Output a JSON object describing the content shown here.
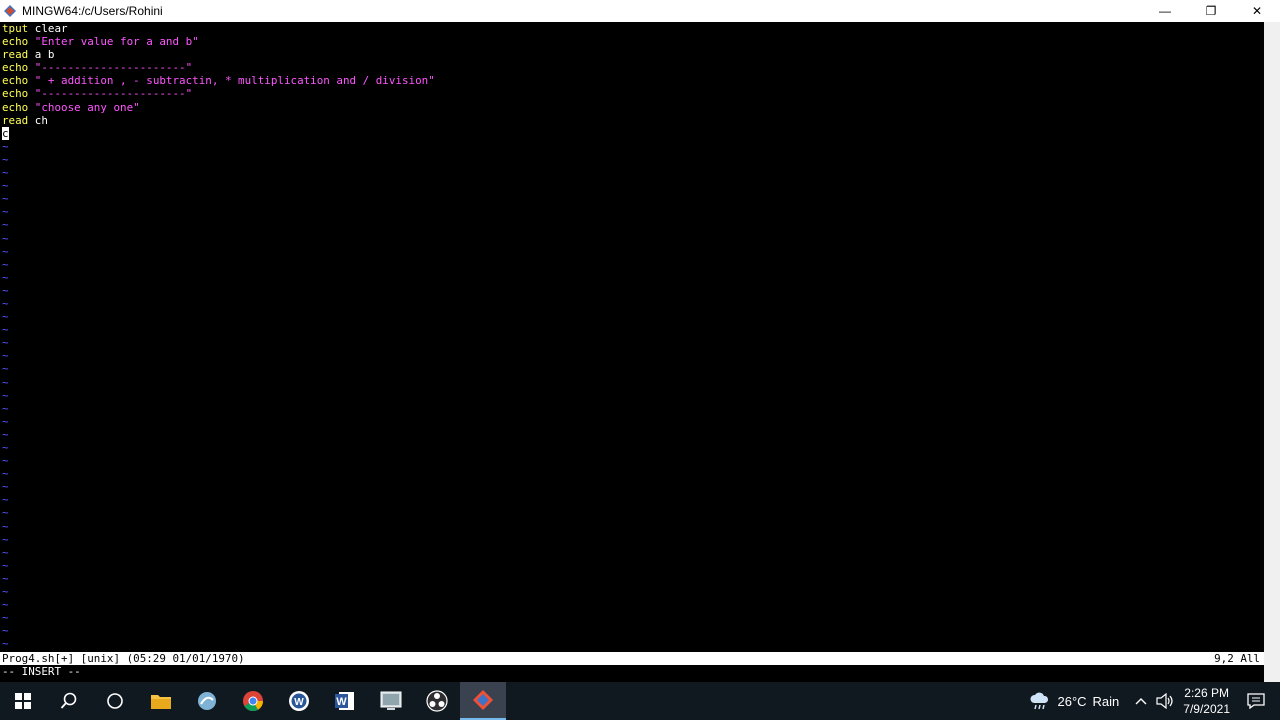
{
  "window": {
    "title": "MINGW64:/c/Users/Rohini",
    "minimize_label": "—",
    "maximize_label": "❐",
    "close_label": "✕"
  },
  "editor": {
    "lines": [
      {
        "kw": "tput",
        "rest": " clear",
        "rest_type": "plain"
      },
      {
        "kw": "echo",
        "rest": " \"Enter value for a and b\"",
        "rest_type": "str"
      },
      {
        "kw": "read",
        "rest": " a b",
        "rest_type": "plain"
      },
      {
        "kw": "echo",
        "rest": " \"----------------------\"",
        "rest_type": "str"
      },
      {
        "kw": "echo",
        "rest": " \" + addition , - subtractin, * multiplication and / division\"",
        "rest_type": "str"
      },
      {
        "kw": "echo",
        "rest": " \"----------------------\"",
        "rest_type": "str"
      },
      {
        "kw": "echo",
        "rest": " \"choose any one\"",
        "rest_type": "str"
      },
      {
        "kw": "read",
        "rest": " ch",
        "rest_type": "plain"
      },
      {
        "kw": "",
        "rest": "c",
        "rest_type": "cursor"
      }
    ],
    "tilde_char": "~",
    "status_left": "Prog4.sh[+] [unix] (05:29 01/01/1970)",
    "status_right": "9,2 All",
    "mode": "-- INSERT --"
  },
  "taskbar": {
    "apps": [
      {
        "name": "start",
        "icon": "windows-icon"
      },
      {
        "name": "search",
        "icon": "search-icon"
      },
      {
        "name": "task-view",
        "icon": "task-view-icon"
      },
      {
        "name": "file-explorer",
        "icon": "folder-icon"
      },
      {
        "name": "app-2",
        "icon": "app-icon"
      },
      {
        "name": "chrome",
        "icon": "chrome-icon"
      },
      {
        "name": "word-circle",
        "icon": "word-circle-icon"
      },
      {
        "name": "word",
        "icon": "word-icon"
      },
      {
        "name": "app-window",
        "icon": "window-app-icon"
      },
      {
        "name": "obs",
        "icon": "obs-icon"
      },
      {
        "name": "git-bash",
        "icon": "git-icon"
      }
    ],
    "weather": {
      "temp": "26°C",
      "condition": "Rain"
    },
    "clock": {
      "time": "2:26 PM",
      "date": "7/9/2021"
    }
  },
  "colors": {
    "keyword": "#ffff55",
    "string": "#ff55ff",
    "tilde": "#5555ff"
  }
}
